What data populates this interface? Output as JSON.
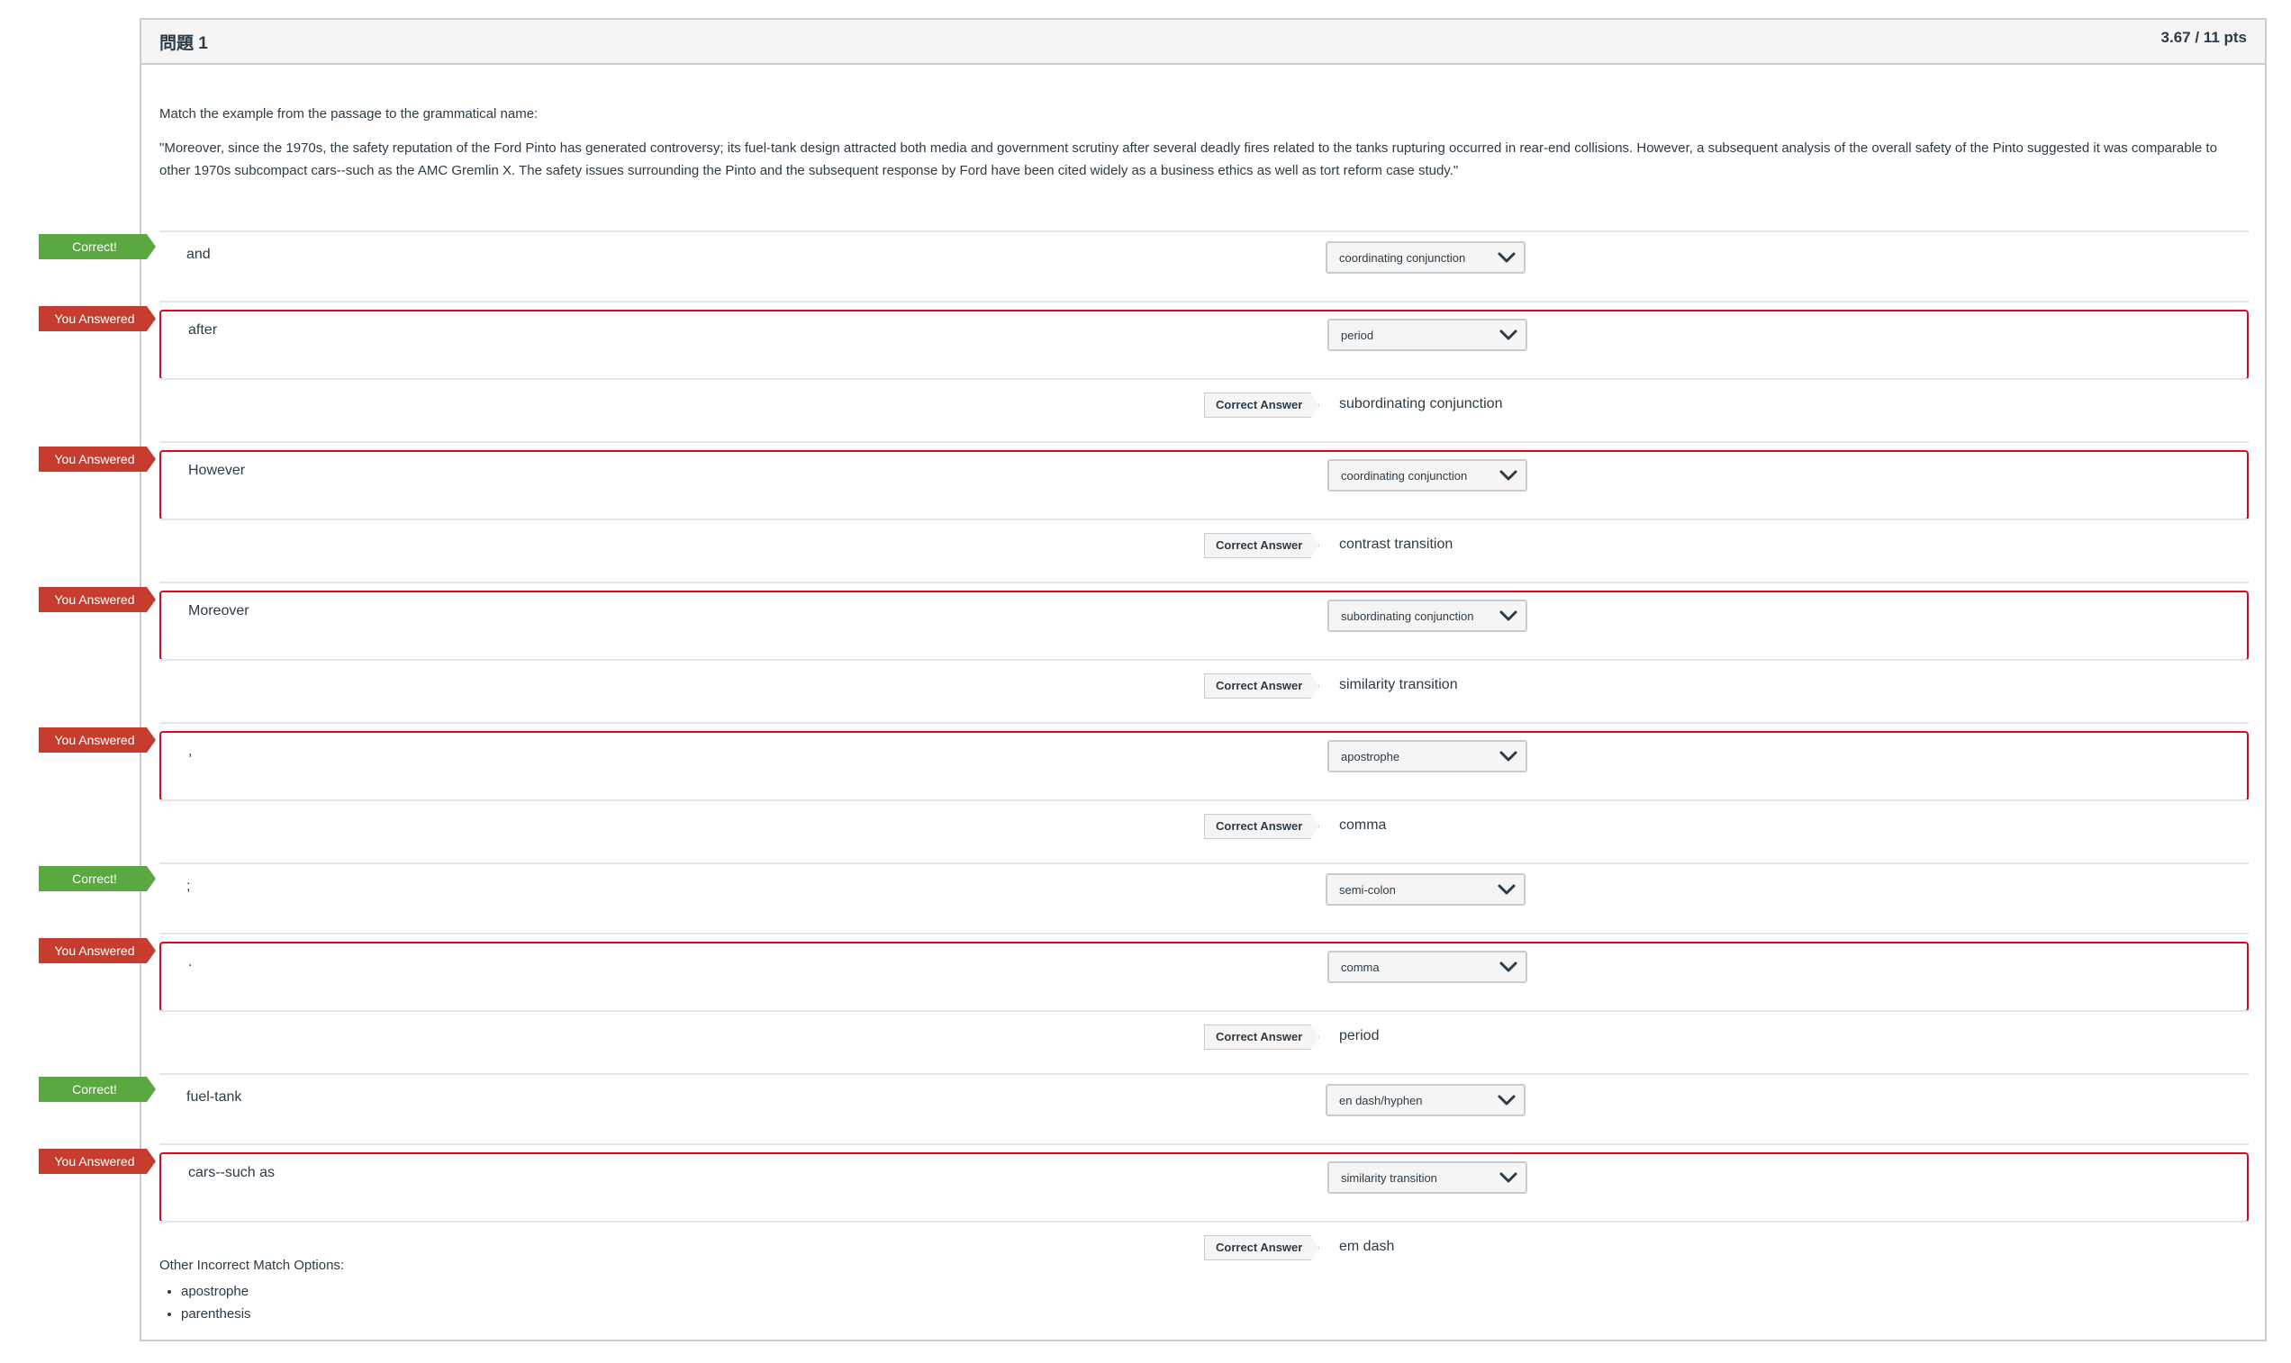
{
  "question": {
    "title": "問題 1",
    "points": "3.67 / 11 pts",
    "prompt": "Match the example from the passage to the grammatical name:",
    "passage": "\"Moreover, since the 1970s, the safety reputation of the Ford Pinto has generated controversy; its fuel-tank design attracted both media and government scrutiny after several deadly fires related to the tanks rupturing occurred in rear-end collisions. However, a subsequent analysis of the overall safety of the Pinto suggested it was comparable to other 1970s subcompact cars--such as the AMC Gremlin X. The safety issues surrounding the Pinto and the subsequent response by Ford have been cited widely as a business ethics as well as tort reform case study.\""
  },
  "labels": {
    "correct_badge": "Correct!",
    "wrong_badge": "You Answered",
    "correct_answer_tag": "Correct Answer",
    "other_options_title": "Other Incorrect Match Options:"
  },
  "items": [
    {
      "term": "and",
      "selected": "coordinating conjunction",
      "status": "correct",
      "correct_answer": null
    },
    {
      "term": "after",
      "selected": "period",
      "status": "wrong",
      "correct_answer": "subordinating conjunction"
    },
    {
      "term": "However",
      "selected": "coordinating conjunction",
      "status": "wrong",
      "correct_answer": "contrast transition"
    },
    {
      "term": "Moreover",
      "selected": "subordinating conjunction",
      "status": "wrong",
      "correct_answer": "similarity transition"
    },
    {
      "term": ",",
      "selected": "apostrophe",
      "status": "wrong",
      "correct_answer": "comma"
    },
    {
      "term": ";",
      "selected": "semi-colon",
      "status": "correct",
      "correct_answer": null
    },
    {
      "term": ".",
      "selected": "comma",
      "status": "wrong",
      "correct_answer": "period"
    },
    {
      "term": "fuel-tank",
      "selected": "en dash/hyphen",
      "status": "correct",
      "correct_answer": null
    },
    {
      "term": "cars--such as",
      "selected": "similarity transition",
      "status": "wrong",
      "correct_answer": "em dash"
    }
  ],
  "other_options": [
    "apostrophe",
    "parenthesis"
  ]
}
